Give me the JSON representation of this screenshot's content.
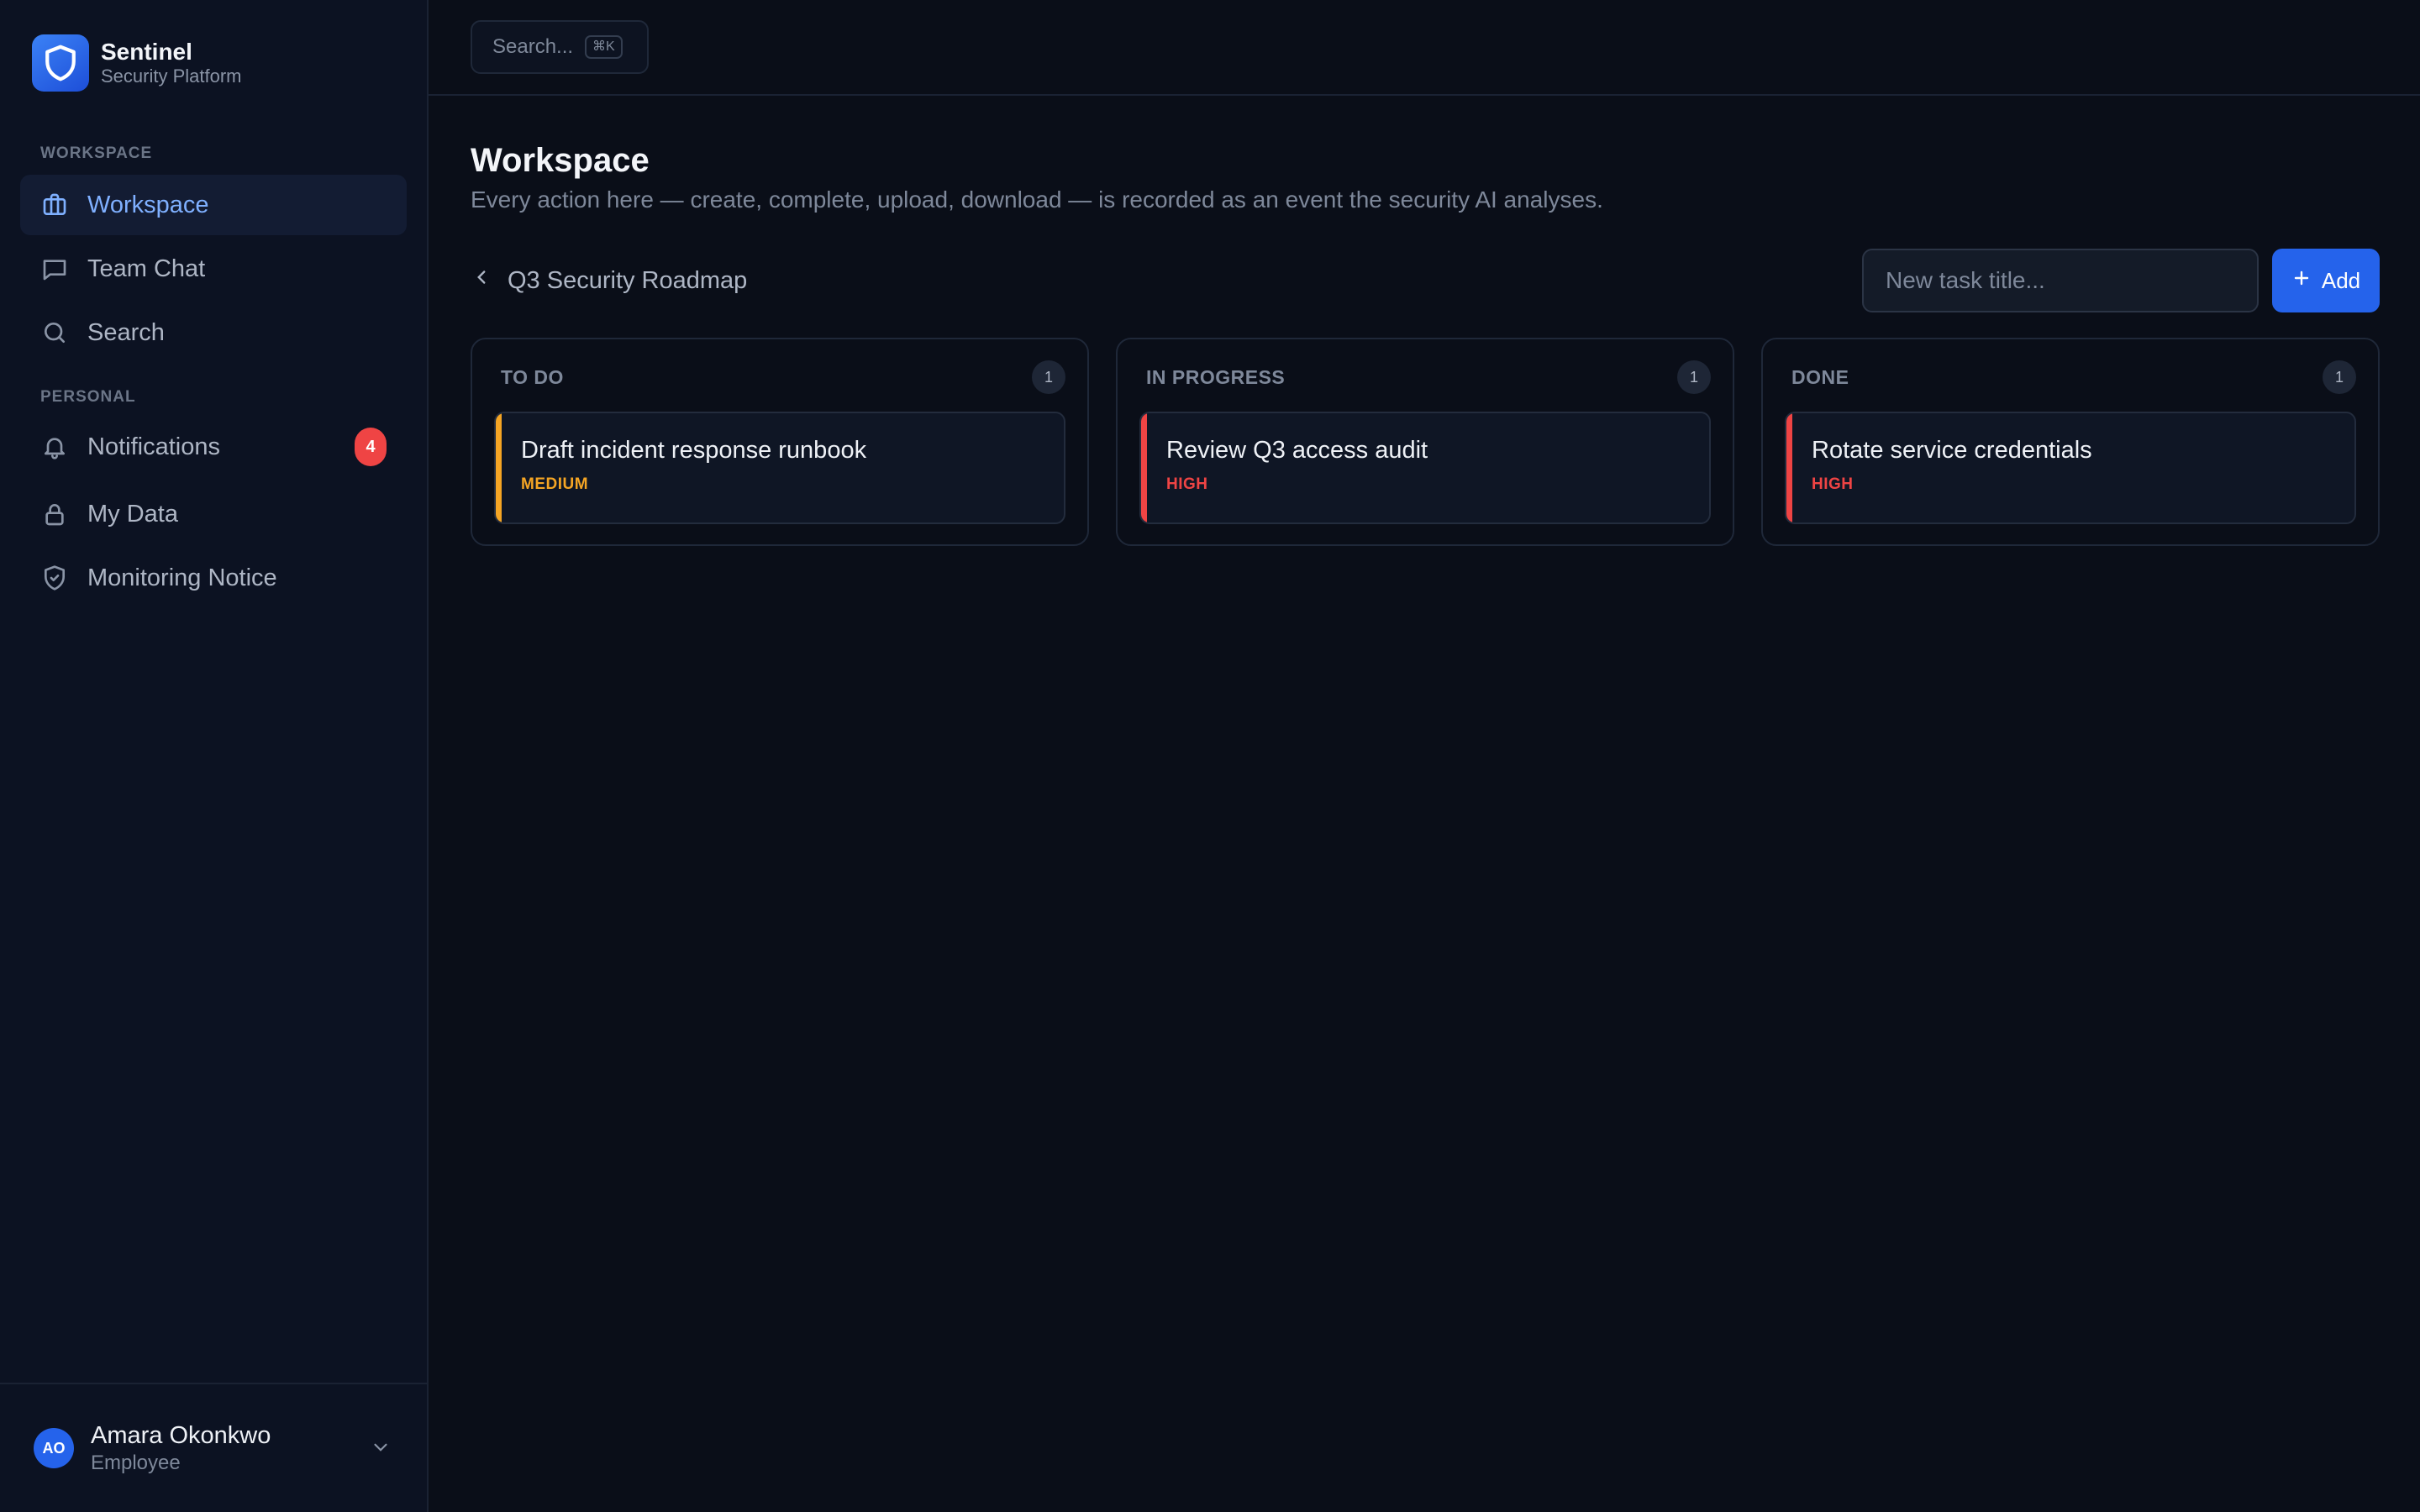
{
  "brand": {
    "name": "Sentinel",
    "subtitle": "Security Platform"
  },
  "sidebar": {
    "sections": [
      {
        "label": "WORKSPACE",
        "items": [
          {
            "label": "Workspace",
            "icon": "briefcase-icon",
            "active": true
          },
          {
            "label": "Team Chat",
            "icon": "chat-icon"
          },
          {
            "label": "Search",
            "icon": "search-icon"
          }
        ]
      },
      {
        "label": "PERSONAL",
        "items": [
          {
            "label": "Notifications",
            "icon": "bell-icon",
            "badge": "4"
          },
          {
            "label": "My Data",
            "icon": "lock-icon"
          },
          {
            "label": "Monitoring Notice",
            "icon": "shield-check-icon"
          }
        ]
      }
    ]
  },
  "user": {
    "initials": "AO",
    "name": "Amara Okonkwo",
    "role": "Employee"
  },
  "topbar": {
    "search_placeholder": "Search...",
    "shortcut": "⌘K"
  },
  "page": {
    "title": "Workspace",
    "description": "Every action here — create, complete, upload, download — is recorded as an event the security AI analyses."
  },
  "board": {
    "name": "Q3 Security Roadmap",
    "new_task_placeholder": "New task title...",
    "add_label": "Add",
    "columns": [
      {
        "title": "TO DO",
        "count": "1",
        "cards": [
          {
            "title": "Draft incident response runbook",
            "priority": "MEDIUM",
            "color": "#f5a524"
          }
        ]
      },
      {
        "title": "IN PROGRESS",
        "count": "1",
        "cards": [
          {
            "title": "Review Q3 access audit",
            "priority": "HIGH",
            "color": "#ef4444"
          }
        ]
      },
      {
        "title": "DONE",
        "count": "1",
        "cards": [
          {
            "title": "Rotate service credentials",
            "priority": "HIGH",
            "color": "#ef4444"
          }
        ]
      }
    ]
  },
  "colors": {
    "accent": "#2563eb",
    "medium": "#f5a524",
    "high": "#ef4444",
    "badge": "#ef4444"
  }
}
